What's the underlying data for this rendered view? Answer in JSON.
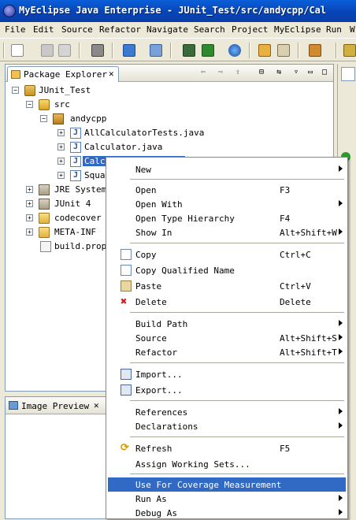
{
  "window": {
    "title": "MyEclipse Java Enterprise - JUnit_Test/src/andycpp/Cal"
  },
  "menubar": [
    "File",
    "Edit",
    "Source",
    "Refactor",
    "Navigate",
    "Search",
    "Project",
    "MyEclipse",
    "Run",
    "W"
  ],
  "explorer": {
    "tab_label": "Package Explorer",
    "tree": [
      {
        "label": "JUnit_Test",
        "icon": "project-icon"
      },
      {
        "label": "src",
        "icon": "source-folder-icon"
      },
      {
        "label": "andycpp",
        "icon": "package-icon"
      },
      {
        "label": "AllCalculatorTests.java",
        "icon": "java-file-icon"
      },
      {
        "label": "Calculator.java",
        "icon": "java-file-icon"
      },
      {
        "label": "CalculatorTest.java",
        "icon": "java-file-icon",
        "selected": true
      },
      {
        "label": "Squa",
        "icon": "java-file-icon"
      },
      {
        "label": "JRE System",
        "icon": "library-icon"
      },
      {
        "label": "JUnit 4",
        "icon": "library-icon"
      },
      {
        "label": "codecover",
        "icon": "folder-icon"
      },
      {
        "label": "META-INF",
        "icon": "folder-icon"
      },
      {
        "label": "build.prope",
        "icon": "file-icon"
      }
    ]
  },
  "preview": {
    "tab_label": "Image Preview"
  },
  "context_menu": {
    "items": [
      {
        "label": "New",
        "shortcut": "",
        "submenu": true
      },
      {
        "label": "Open",
        "shortcut": "F3"
      },
      {
        "label": "Open With",
        "shortcut": "",
        "submenu": true
      },
      {
        "label": "Open Type Hierarchy",
        "shortcut": "F4"
      },
      {
        "label": "Show In",
        "shortcut": "Alt+Shift+W",
        "submenu": true
      },
      {
        "label": "Copy",
        "shortcut": "Ctrl+C",
        "icon": "copy-icon"
      },
      {
        "label": "Copy Qualified Name",
        "shortcut": "",
        "icon": "copy-icon"
      },
      {
        "label": "Paste",
        "shortcut": "Ctrl+V",
        "icon": "paste-icon"
      },
      {
        "label": "Delete",
        "shortcut": "Delete",
        "icon": "delete-icon"
      },
      {
        "label": "Build Path",
        "shortcut": "",
        "submenu": true
      },
      {
        "label": "Source",
        "shortcut": "Alt+Shift+S",
        "submenu": true
      },
      {
        "label": "Refactor",
        "shortcut": "Alt+Shift+T",
        "submenu": true
      },
      {
        "label": "Import...",
        "shortcut": "",
        "icon": "import-icon"
      },
      {
        "label": "Export...",
        "shortcut": "",
        "icon": "export-icon"
      },
      {
        "label": "References",
        "shortcut": "",
        "submenu": true
      },
      {
        "label": "Declarations",
        "shortcut": "",
        "submenu": true
      },
      {
        "label": "Refresh",
        "shortcut": "F5",
        "icon": "refresh-icon"
      },
      {
        "label": "Assign Working Sets...",
        "shortcut": ""
      },
      {
        "label": "Use For Coverage Measurement",
        "shortcut": "",
        "highlighted": true
      },
      {
        "label": "Run As",
        "shortcut": "",
        "submenu": true
      },
      {
        "label": "Debug As",
        "shortcut": "",
        "submenu": true
      }
    ]
  },
  "colors": {
    "selection": "#316ac5",
    "titlebar": "#0a5fd8",
    "chrome": "#ece9d8"
  }
}
